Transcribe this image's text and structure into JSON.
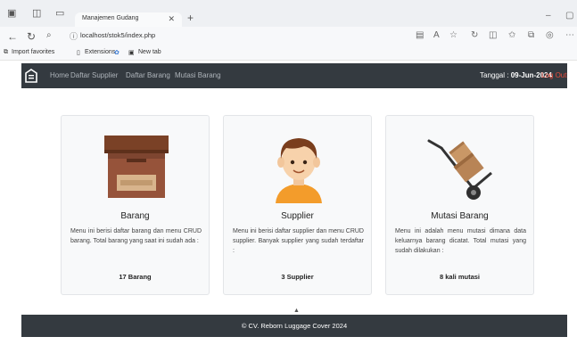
{
  "browser": {
    "tab_title": "Manajemen Gudang",
    "url": "localhost/stok5/index.php",
    "favorites": [
      "Import favorites",
      "Extensions",
      "New tab"
    ]
  },
  "navbar": {
    "links": [
      "Home",
      "Daftar Supplier",
      "Daftar Barang",
      "Mutasi Barang"
    ],
    "date_label": "Tanggal :",
    "date_value": "09-Jun-2024",
    "logout": "Log Out"
  },
  "cards": [
    {
      "title": "Barang",
      "text": "Menu ini berisi daftar barang dan menu CRUD barang. Total barang yang saat ini sudah ada :",
      "count": "17 Barang",
      "icon": "box-icon"
    },
    {
      "title": "Supplier",
      "text": "Menu ini berisi daftar supplier dan menu CRUD supplier. Banyak supplier yang sudah terdaftar :",
      "count": "3 Supplier",
      "icon": "person-icon"
    },
    {
      "title": "Mutasi Barang",
      "text": "Menu ini adalah menu mutasi dimana data keluarnya barang dicatat. Total mutasi yang sudah dilakukan :",
      "count": "8 kali mutasi",
      "icon": "hand-truck-icon"
    }
  ],
  "footer": "© CV. Reborn Luggage Cover 2024",
  "colors": {
    "navbar": "#343a40",
    "logout": "#e74c3c",
    "card_bg": "#f8f9fa"
  }
}
